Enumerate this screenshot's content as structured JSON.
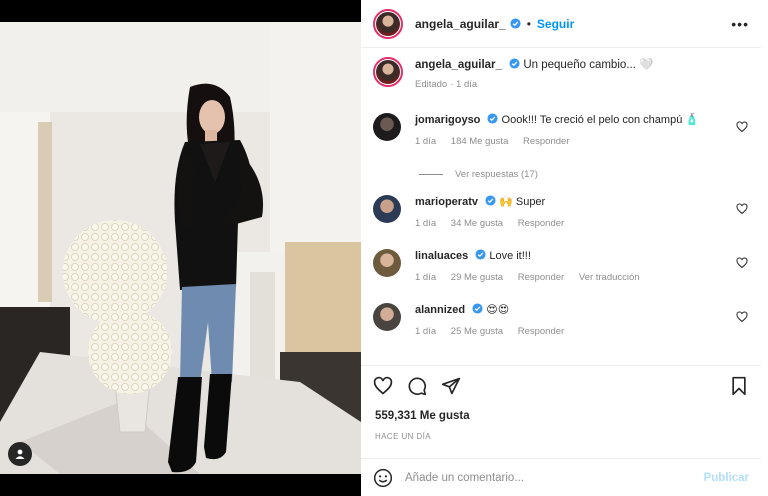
{
  "post": {
    "author": "angela_aguilar_",
    "follow_label": "Seguir",
    "more_label": "•••",
    "separator": "•"
  },
  "caption": {
    "author": "angela_aguilar_",
    "text": "Un pequeño cambio... 🤍",
    "edited": "Editado",
    "time": "· 1 día"
  },
  "comments": [
    {
      "username": "jomarigoyso",
      "text": "Oook!!! Te creció el pelo con champú 🧴",
      "time": "1 día",
      "likes": "184 Me gusta",
      "reply": "Responder",
      "translate": ""
    },
    {
      "username": "marioperatv",
      "text": "🙌 Super",
      "time": "1 día",
      "likes": "34 Me gusta",
      "reply": "Responder",
      "translate": ""
    },
    {
      "username": "linaluaces",
      "text": "Love it!!!",
      "time": "1 día",
      "likes": "29 Me gusta",
      "reply": "Responder",
      "translate": "Ver traducción"
    },
    {
      "username": "alannized",
      "text": "😍😍",
      "time": "1 día",
      "likes": "25 Me gusta",
      "reply": "Responder",
      "translate": ""
    }
  ],
  "view_replies": "Ver respuestas (17)",
  "likes_count": "559,331 Me gusta",
  "posted_time": "HACE UN DÍA",
  "add_comment": {
    "placeholder": "Añade un comentario...",
    "post_label": "Publicar"
  },
  "icons": {
    "verified": "verified-badge-icon",
    "like": "heart-icon",
    "comment": "comment-bubble-icon",
    "share": "paper-plane-icon",
    "save": "bookmark-icon",
    "emoji": "smiley-face-icon",
    "tag": "user-tag-icon"
  },
  "colors": {
    "accent": "#0095f6",
    "verified": "#3897f0",
    "muted": "#8e8e8e",
    "text": "#262626"
  }
}
